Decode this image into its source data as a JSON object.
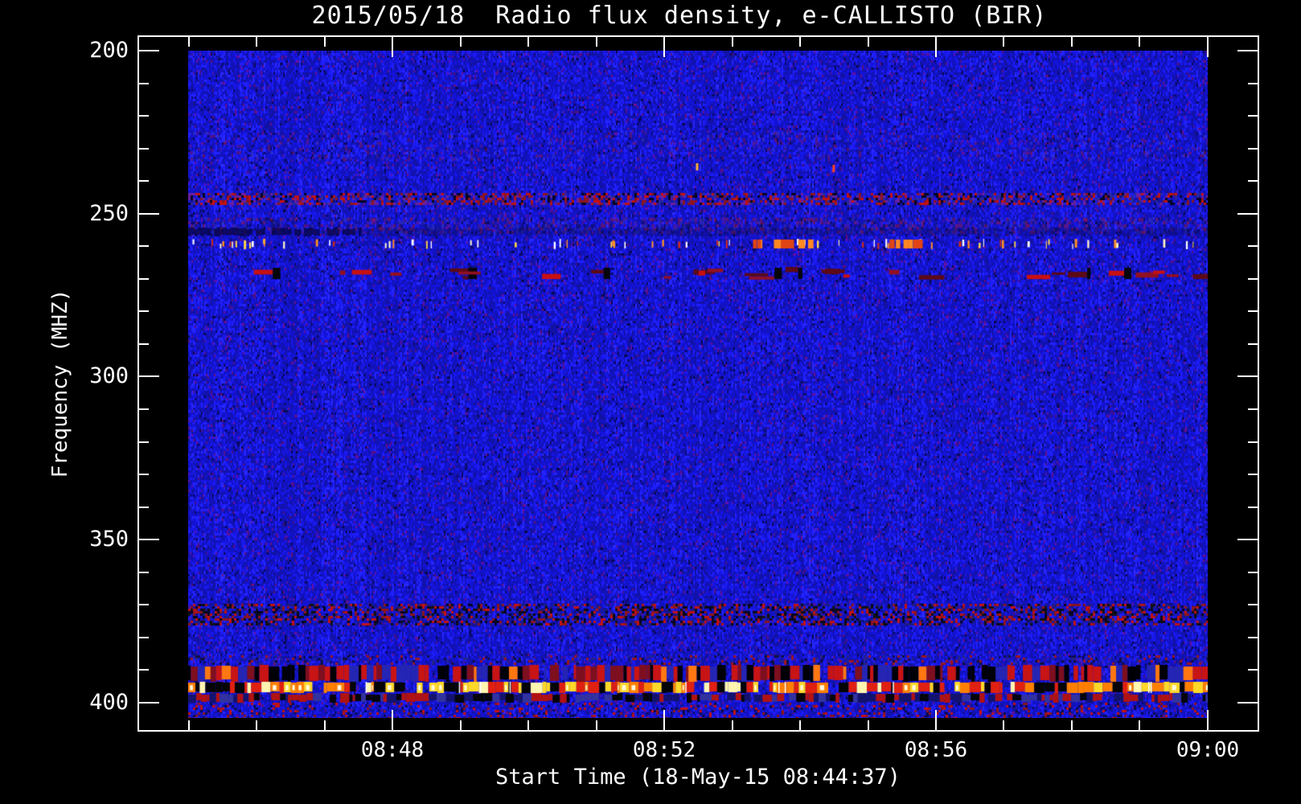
{
  "title": "2015/05/18  Radio flux density, e-CALLISTO (BIR)",
  "y_axis": {
    "label": "Frequency (MHZ)",
    "unit": "MHz",
    "range": [
      200,
      400
    ],
    "minor_step_mhz": 10,
    "major_ticks": [
      {
        "f": 200,
        "label": "200"
      },
      {
        "f": 250,
        "label": "250"
      },
      {
        "f": 300,
        "label": "300"
      },
      {
        "f": 350,
        "label": "350"
      },
      {
        "f": 400,
        "label": "400"
      }
    ]
  },
  "x_axis": {
    "title": "Start Time (18-May-15 08:44:37)",
    "start_time_label": "08:44:37",
    "minor_step": "1 min",
    "ticks": [
      {
        "m": 0,
        "time": "08:45",
        "major": false
      },
      {
        "m": 1,
        "time": "08:46",
        "major": false
      },
      {
        "m": 2,
        "time": "08:47",
        "major": false
      },
      {
        "m": 3,
        "time": "08:48",
        "major": true,
        "label": "08:48"
      },
      {
        "m": 4,
        "time": "08:49",
        "major": false
      },
      {
        "m": 5,
        "time": "08:50",
        "major": false
      },
      {
        "m": 6,
        "time": "08:51",
        "major": false
      },
      {
        "m": 7,
        "time": "08:52",
        "major": true,
        "label": "08:52"
      },
      {
        "m": 8,
        "time": "08:53",
        "major": false
      },
      {
        "m": 9,
        "time": "08:54",
        "major": false
      },
      {
        "m": 10,
        "time": "08:55",
        "major": false
      },
      {
        "m": 11,
        "time": "08:56",
        "major": true,
        "label": "08:56"
      },
      {
        "m": 12,
        "time": "08:57",
        "major": false
      },
      {
        "m": 13,
        "time": "08:58",
        "major": false
      },
      {
        "m": 14,
        "time": "08:59",
        "major": false
      },
      {
        "m": 15,
        "time": "09:00",
        "major": true,
        "label": "09:00"
      }
    ]
  },
  "chart_data": {
    "type": "heatmap",
    "subtype": "radio-spectrogram",
    "instrument": "e-CALLISTO (BIR)",
    "date": "2015/05/18",
    "time_range": [
      "08:44:37",
      "09:00"
    ],
    "freq_range_mhz": [
      200,
      404.7
    ],
    "freq_axis_inverted": true,
    "description": "Quiet blue noise background with horizontal RFI bands; no solar burst visible",
    "background": {
      "base_color": "#1e1ed8",
      "dark_color": "#0a0a50",
      "purple_color": "#5a1a8c",
      "striation": "vertical"
    },
    "rfi_bands": [
      {
        "name": "faint purple mottle",
        "f0": 225,
        "f1": 233,
        "style": "mottle",
        "density": 0.1,
        "colors": [
          "#5a1a8c",
          "#7c1544",
          "#3a3acf"
        ]
      },
      {
        "name": "speckle band 244-246 MHz",
        "f0": 243.6,
        "f1": 246.8,
        "style": "speckle",
        "density": 0.55,
        "colors": [
          "#c31111",
          "#8c1520",
          "#050522",
          "#27279f",
          "#6a1f9f"
        ]
      },
      {
        "name": "congested mottle 251-256 MHz",
        "f0": 251.3,
        "f1": 256.3,
        "style": "mottle",
        "density": 0.4,
        "colors": [
          "#5a1a8c",
          "#93173a",
          "#32329f",
          "#0c0c50"
        ]
      },
      {
        "name": "dark smudge left 255 MHz",
        "f0": 254.2,
        "f1": 256.9,
        "style": "smudge",
        "x0": 0.0,
        "x1": 0.17,
        "color": "#050545",
        "alpha": 0.75
      },
      {
        "name": "dark patches 255 MHz",
        "f0": 254.2,
        "f1": 256.9,
        "style": "smudge",
        "x0": 0.17,
        "x1": 1.0,
        "color": "#0a0a55",
        "alpha": 0.3
      },
      {
        "name": "bright carrier dashes 258-261 MHz",
        "f0": 257.8,
        "f1": 260.9,
        "style": "bright-dashes",
        "count": 78,
        "colors": [
          "#ffffff",
          "#fff7c0",
          "#ffd84a",
          "#ff9022",
          "#d22a10"
        ],
        "hot_spots": [
          [
            0.55,
            0.61
          ],
          [
            0.685,
            0.72
          ]
        ]
      },
      {
        "name": "red dashes 266-270 MHz",
        "f0": 266.4,
        "f1": 270.2,
        "style": "red-dashes",
        "count": 30,
        "colors": [
          "#c81010",
          "#911022",
          "#5c0a16"
        ]
      },
      {
        "name": "speckle band 370-376 MHz",
        "f0": 369.8,
        "f1": 376.0,
        "style": "speckle",
        "density": 0.5,
        "colors": [
          "#c31111",
          "#101014",
          "#8c1520",
          "#1b1b85",
          "#050522"
        ]
      },
      {
        "name": "faint speckle 385-388 MHz",
        "f0": 385.5,
        "f1": 388.5,
        "style": "speckle",
        "density": 0.2,
        "colors": [
          "#9c1520",
          "#101040",
          "#23238f"
        ]
      },
      {
        "name": "strong block band 388-394 MHz",
        "f0": 388.5,
        "f1": 393.6,
        "style": "blocks",
        "colors": [
          "#000006",
          "#c81414",
          "#7e0f1e",
          "#2525b4",
          "#ff7711"
        ],
        "weights": [
          0.3,
          0.26,
          0.16,
          0.18,
          0.1
        ]
      },
      {
        "name": "bright burst row 394-397 MHz",
        "f0": 393.6,
        "f1": 397.0,
        "style": "bright-blobs",
        "colors": [
          "#ffd828",
          "#fff6b0",
          "#ff8000",
          "#e02010",
          "#050505",
          ""
        ],
        "weights": [
          0.24,
          0.1,
          0.2,
          0.2,
          0.16,
          0.1
        ]
      },
      {
        "name": "block band 397-400 MHz",
        "f0": 397.0,
        "f1": 399.9,
        "style": "blocks",
        "colors": [
          "#05050a",
          "#b01212",
          "#32329f",
          "#13136e"
        ],
        "weights": [
          0.28,
          0.3,
          0.22,
          0.2
        ]
      },
      {
        "name": "bottom speckle 400-405 MHz",
        "f0": 399.9,
        "f1": 404.7,
        "style": "speckle",
        "density": 0.18,
        "colors": [
          "#c31111",
          "#8c1520",
          "#0a0a50"
        ]
      }
    ],
    "isolated_marks": [
      {
        "x_frac": 0.498,
        "f": 234.6,
        "color": "#ffb030",
        "note": "tiny bright dot"
      },
      {
        "x_frac": 0.632,
        "f": 234.9,
        "color": "#ff4422",
        "note": "tiny bright dot"
      }
    ]
  }
}
